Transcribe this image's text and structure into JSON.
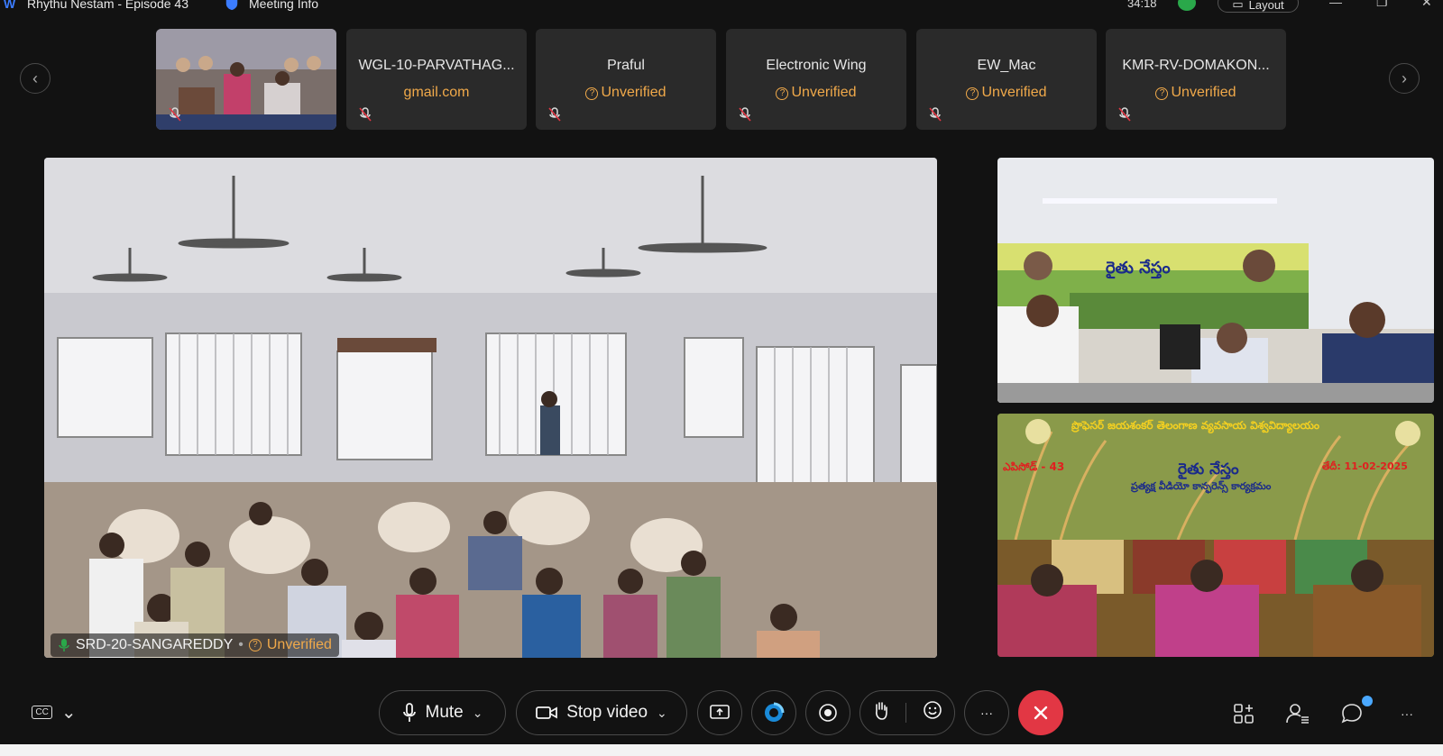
{
  "window": {
    "title": "Rhythu Nestam - Episode 43",
    "meeting_info": "Meeting Info",
    "timer": "34:18",
    "layout_label": "Layout",
    "minimize": "—",
    "maximize": "❐",
    "close": "✕"
  },
  "strip": {
    "prev_icon": "‹",
    "next_icon": "›",
    "tiles": [
      {
        "type": "video",
        "muted": true
      },
      {
        "name": "WGL-10-PARVATHAG...",
        "status": "gmail.com",
        "muted": true
      },
      {
        "name": "Praful",
        "status": "Unverified",
        "muted": true
      },
      {
        "name": "Electronic Wing",
        "status": "Unverified",
        "muted": true
      },
      {
        "name": "EW_Mac",
        "status": "Unverified",
        "muted": true
      },
      {
        "name": "KMR-RV-DOMAKON...",
        "status": "Unverified",
        "muted": true
      }
    ]
  },
  "main_video": {
    "participant": "SRD-20-SANGAREDDY",
    "separator": "•",
    "status": "Unverified"
  },
  "side_videos": {
    "top_banner": "రైతు నేస్తం",
    "bottom_banner_title": "ప్రొఫెసర్ జయశంకర్ తెలంగాణ వ్యవసాయ విశ్వవిద్యాలయం",
    "bottom_banner_main": "రైతు నేస్తం",
    "bottom_episode": "ఎపిసోడ్ - 43",
    "bottom_date": "తేదీ: 11-02-2025",
    "bottom_subtitle": "ప్రత్యక్ష వీడియో కాన్ఫరెన్స్ కార్యక్రమం"
  },
  "controls": {
    "cc_icon": "CC",
    "mute_label": "Mute",
    "stop_video_label": "Stop video",
    "more_label": "···",
    "overflow_label": "···"
  },
  "colors": {
    "accent_unverified": "#f0a94a",
    "end_call": "#e23744",
    "background": "#121212"
  }
}
